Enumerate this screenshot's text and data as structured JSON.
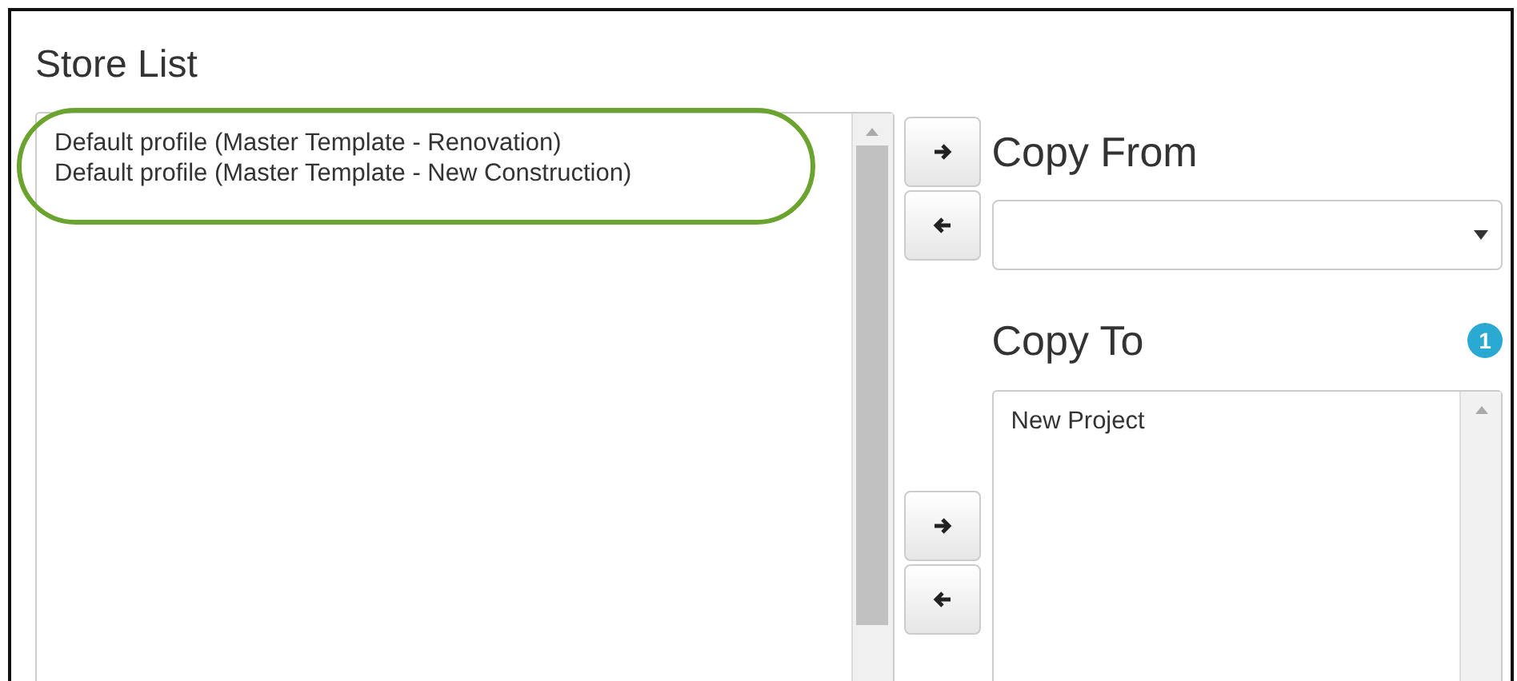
{
  "store_list": {
    "title": "Store List",
    "items": [
      "Default profile (Master Template - Renovation)",
      "Default profile (Master Template - New Construction)"
    ],
    "highlighted": true
  },
  "top_buttons": [
    {
      "kind": "right"
    },
    {
      "kind": "left"
    }
  ],
  "copy_from": {
    "label": "Copy From"
  },
  "copy_to": {
    "label": "Copy To",
    "count": "1",
    "items": [
      "New Project"
    ]
  },
  "bottom_buttons": [
    {
      "kind": "right"
    },
    {
      "kind": "left"
    }
  ]
}
